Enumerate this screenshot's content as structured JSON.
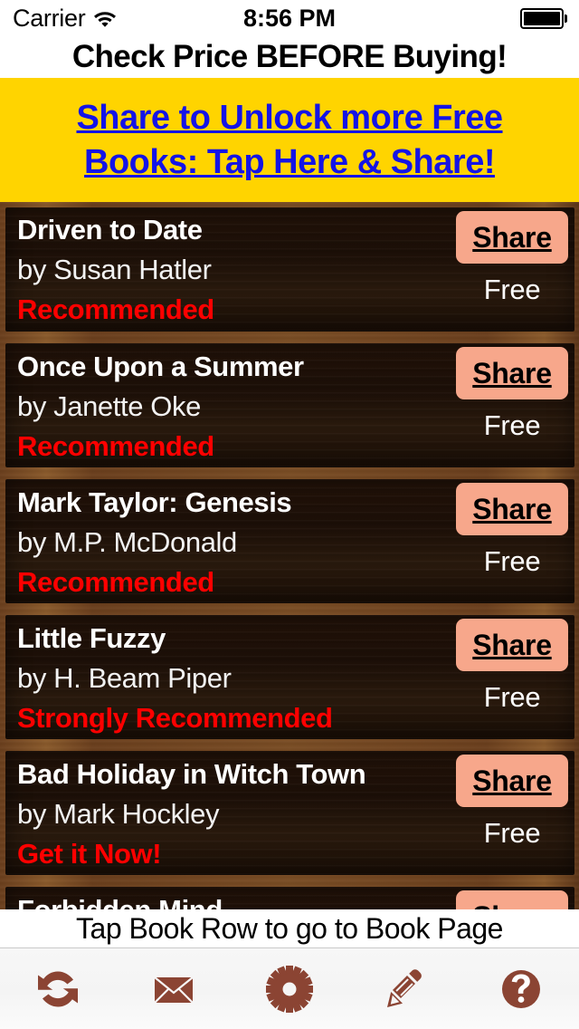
{
  "status_bar": {
    "carrier": "Carrier",
    "wifi_icon": "wifi-icon",
    "time": "8:56 PM",
    "battery_icon": "battery-full-icon"
  },
  "nav": {
    "title": "Check Price BEFORE Buying!"
  },
  "banner": {
    "line1": "Share to Unlock more Free",
    "line2": "Books: Tap Here & Share!",
    "background_color": "#FFD400",
    "text_color": "#1414E6"
  },
  "books": [
    {
      "title": "Driven to Date",
      "author": "by Susan Hatler",
      "recommendation": "Recommended",
      "share_label": "Share",
      "price": "Free"
    },
    {
      "title": "Once Upon a Summer",
      "author": "by Janette Oke",
      "recommendation": "Recommended",
      "share_label": "Share",
      "price": "Free"
    },
    {
      "title": "Mark Taylor: Genesis",
      "author": "by M.P. McDonald",
      "recommendation": "Recommended",
      "share_label": "Share",
      "price": "Free"
    },
    {
      "title": "Little Fuzzy",
      "author": "by H. Beam Piper",
      "recommendation": "Strongly Recommended",
      "share_label": "Share",
      "price": "Free"
    },
    {
      "title": "Bad Holiday in Witch Town",
      "author": "by Mark Hockley",
      "recommendation": "Get it Now!",
      "share_label": "Share",
      "price": "Free"
    },
    {
      "title": "Forbidden Mind",
      "author": "",
      "recommendation": "",
      "share_label": "Share",
      "price": ""
    }
  ],
  "hint": {
    "text": "Tap Book Row to go to Book Page"
  },
  "toolbar": {
    "icon_color": "#8B4433",
    "items": [
      {
        "icon": "refresh-icon"
      },
      {
        "icon": "mail-icon"
      },
      {
        "icon": "gear-icon"
      },
      {
        "icon": "pencil-icon"
      },
      {
        "icon": "help-icon"
      }
    ]
  },
  "colors": {
    "recommendation": "#FF0000",
    "share_button": "#F7A78B",
    "banner_bg": "#FFD400",
    "link_blue": "#1414E6"
  }
}
